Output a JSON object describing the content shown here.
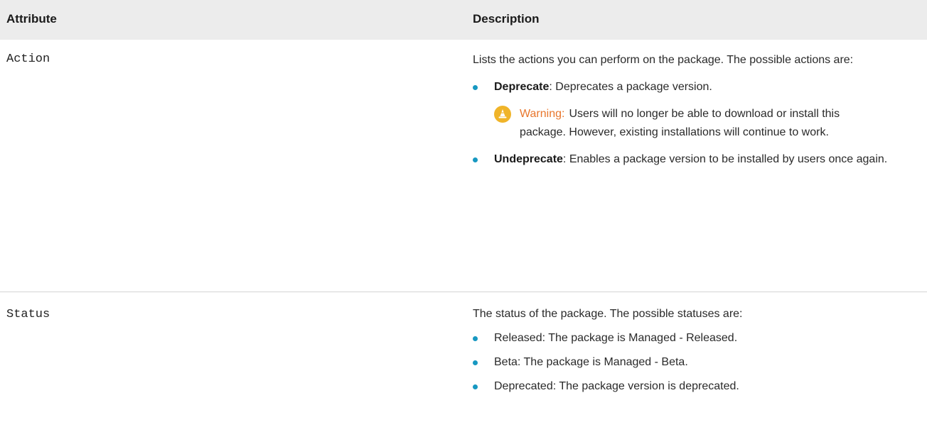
{
  "header": {
    "attribute": "Attribute",
    "description": "Description"
  },
  "rows": [
    {
      "attribute": "Action",
      "intro": "Lists the actions you can perform on the package. The possible actions are:",
      "items": [
        {
          "term": "Deprecate",
          "text": ": Deprecates a package version."
        },
        {
          "term": "Undeprecate",
          "text": ": Enables a package version to be installed by users once again."
        }
      ],
      "warning": {
        "label": "Warning:",
        "text": "Users will no longer be able to download or install this package. However, existing installations will continue to work."
      }
    },
    {
      "attribute": "Status",
      "intro": "The status of the package. The possible statuses are:",
      "items": [
        {
          "text": "Released: The package is Managed - Released."
        },
        {
          "text": "Beta: The package is Managed - Beta."
        },
        {
          "text": "Deprecated: The package version is deprecated."
        }
      ]
    }
  ],
  "colors": {
    "header_bg": "#ececec",
    "bullet": "#1798c1",
    "warning_label": "#e8762c",
    "warning_icon": "#f0b429",
    "divider": "#d4d4d4"
  },
  "icons": {
    "warning": "warning-cone-icon",
    "bullet": "bullet-dot-icon"
  }
}
